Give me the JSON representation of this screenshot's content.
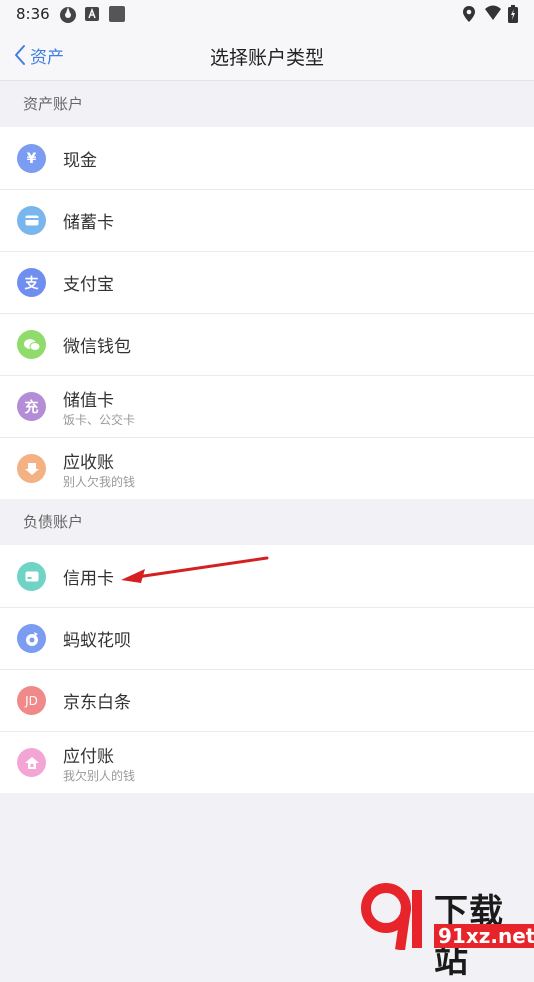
{
  "status_bar": {
    "time": "8:36"
  },
  "nav": {
    "back_label": "资产",
    "title": "选择账户类型"
  },
  "sections": [
    {
      "title": "资产账户",
      "items": [
        {
          "label": "现金",
          "sub": "",
          "icon": "yen-icon",
          "color": "#7b9cf0"
        },
        {
          "label": "储蓄卡",
          "sub": "",
          "icon": "card-icon",
          "color": "#7ab6ee"
        },
        {
          "label": "支付宝",
          "sub": "",
          "icon": "alipay-icon",
          "color": "#6f8ef0"
        },
        {
          "label": "微信钱包",
          "sub": "",
          "icon": "wechat-icon",
          "color": "#8fdc6b"
        },
        {
          "label": "储值卡",
          "sub": "饭卡、公交卡",
          "icon": "recharge-icon",
          "color": "#b38ed6"
        },
        {
          "label": "应收账",
          "sub": "别人欠我的钱",
          "icon": "receivable-icon",
          "color": "#f4b183"
        }
      ]
    },
    {
      "title": "负债账户",
      "items": [
        {
          "label": "信用卡",
          "sub": "",
          "icon": "credit-card-icon",
          "color": "#6fd3c6"
        },
        {
          "label": "蚂蚁花呗",
          "sub": "",
          "icon": "huabei-icon",
          "color": "#7b9cf0"
        },
        {
          "label": "京东白条",
          "sub": "",
          "icon": "jd-icon",
          "color": "#f08a8a"
        },
        {
          "label": "应付账",
          "sub": "我欠别人的钱",
          "icon": "payable-icon",
          "color": "#f3a6d6"
        }
      ]
    }
  ],
  "glyphs": {
    "yen": "¥",
    "alipay": "支",
    "recharge": "充",
    "jd": "JD"
  },
  "watermark": {
    "top": "下载站",
    "bottom": "91xz.net"
  }
}
